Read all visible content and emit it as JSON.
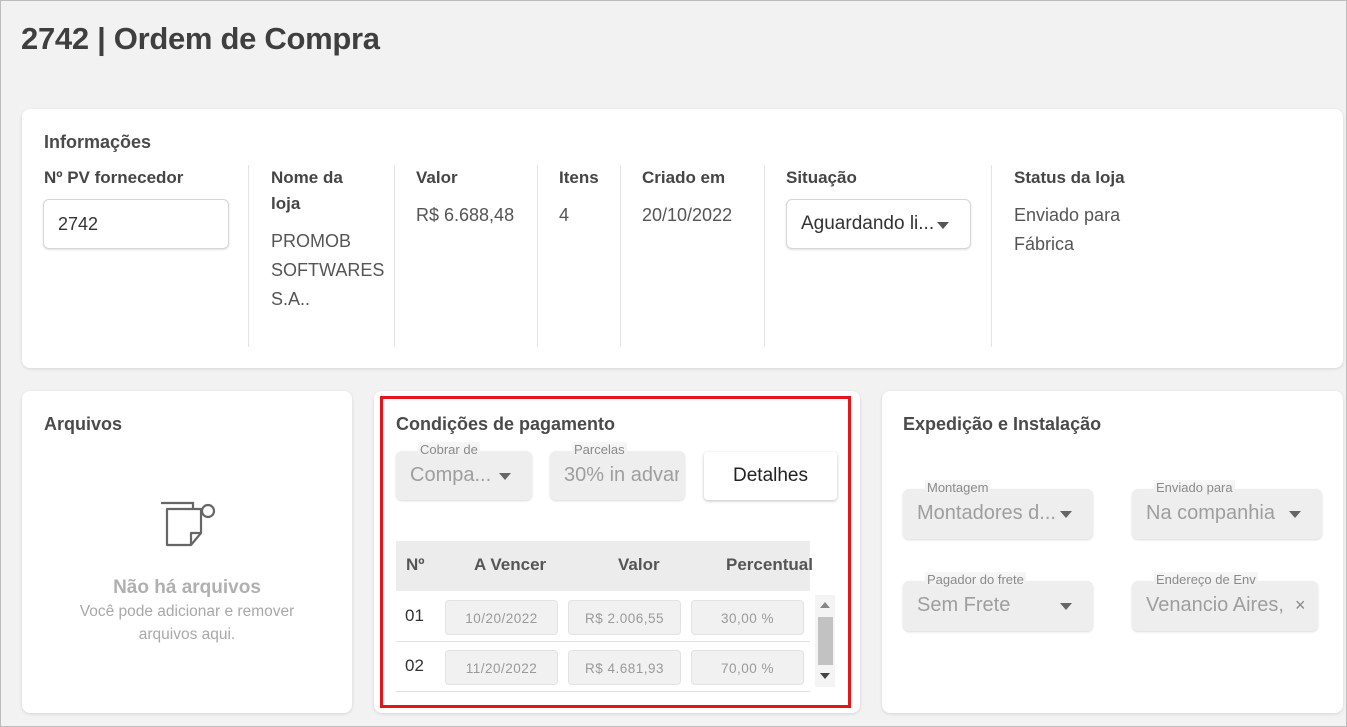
{
  "page": {
    "title": "2742 | Ordem de Compra"
  },
  "info": {
    "title": "Informações",
    "pv_label": "Nº PV fornecedor",
    "pv_value": "2742",
    "store_label_1": "Nome da",
    "store_label_2": "loja",
    "store_value_1": "PROMOB",
    "store_value_2": "SOFTWARES",
    "store_value_3": "S.A..",
    "value_label": "Valor",
    "value_value": "R$ 6.688,48",
    "items_label": "Itens",
    "items_value": "4",
    "created_label": "Criado em",
    "created_value": "20/10/2022",
    "situation_label": "Situação",
    "situation_value": "Aguardando li...",
    "store_status_label": "Status da loja",
    "store_status_value_1": "Enviado para",
    "store_status_value_2": "Fábrica"
  },
  "files": {
    "title": "Arquivos",
    "empty_title": "Não há arquivos",
    "empty_subtitle": "Você pode adicionar e remover arquivos aqui.",
    "icon": "files-icon"
  },
  "payment": {
    "title": "Condições de pagamento",
    "charge_label": "Cobrar de",
    "charge_value": "Compa...",
    "installments_label": "Parcelas",
    "installments_value": "30% in advar",
    "details_button": "Detalhes",
    "columns": [
      "Nº",
      "A Vencer",
      "Valor",
      "Percentual"
    ],
    "rows": [
      {
        "num": "01",
        "due": "10/20/2022",
        "value": "R$ 2.006,55",
        "percent": "30,00 %"
      },
      {
        "num": "02",
        "due": "11/20/2022",
        "value": "R$ 4.681,93",
        "percent": "70,00 %"
      }
    ],
    "highlight_color": "#e4141b"
  },
  "shipping": {
    "title": "Expedição e Instalação",
    "assembly_label": "Montagem",
    "assembly_value": "Montadores d...",
    "sent_to_label": "Enviado para",
    "sent_to_value": "Na companhia",
    "freight_payer_label": "Pagador do frete",
    "freight_payer_value": "Sem Frete",
    "address_label": "Endereço de Env",
    "address_value": "Venancio Aires,",
    "clear_symbol": "×"
  }
}
